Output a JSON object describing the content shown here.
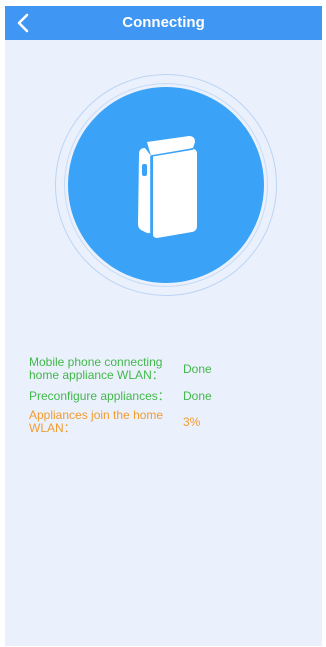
{
  "header": {
    "title": "Connecting",
    "back_icon": "chevron-left-icon"
  },
  "illustration": {
    "icon": "portable-air-conditioner-icon"
  },
  "steps": [
    {
      "label": "Mobile phone connecting home appliance WLAN：",
      "value": "Done",
      "state": "done"
    },
    {
      "label": "Preconfigure appliances：",
      "value": "Done",
      "state": "done"
    },
    {
      "label": "Appliances join the home WLAN：",
      "value": "3%",
      "state": "in-progress"
    }
  ],
  "colors": {
    "header": "#3f96f3",
    "background": "#eaf1fd",
    "disc": "#3aa3f7",
    "done": "#42b84a",
    "in_progress": "#f29b2f"
  }
}
